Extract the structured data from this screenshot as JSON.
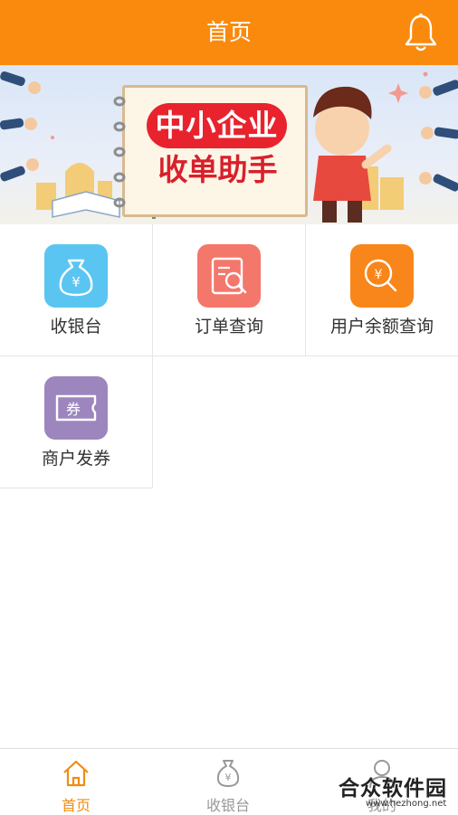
{
  "header": {
    "title": "首页"
  },
  "banner": {
    "line1": "中小企业",
    "line2": "收单助手"
  },
  "grid": {
    "items": [
      {
        "label": "收银台",
        "icon": "money-bag-icon",
        "color": "#5bc5f2"
      },
      {
        "label": "订单查询",
        "icon": "order-search-icon",
        "color": "#f4776b"
      },
      {
        "label": "用户余额查询",
        "icon": "balance-search-icon",
        "color": "#f9861a"
      },
      {
        "label": "商户发券",
        "icon": "coupon-icon",
        "color": "#9c86bd"
      }
    ]
  },
  "tabbar": {
    "tabs": [
      {
        "label": "首页",
        "icon": "home-icon",
        "active": true
      },
      {
        "label": "收银台",
        "icon": "money-bag-icon",
        "active": false
      },
      {
        "label": "我的",
        "icon": "user-icon",
        "active": false
      }
    ],
    "active_color": "#f08c13",
    "inactive_color": "#999999"
  },
  "watermark": {
    "text": "合众软件园",
    "url": "www.hezhong.net"
  }
}
